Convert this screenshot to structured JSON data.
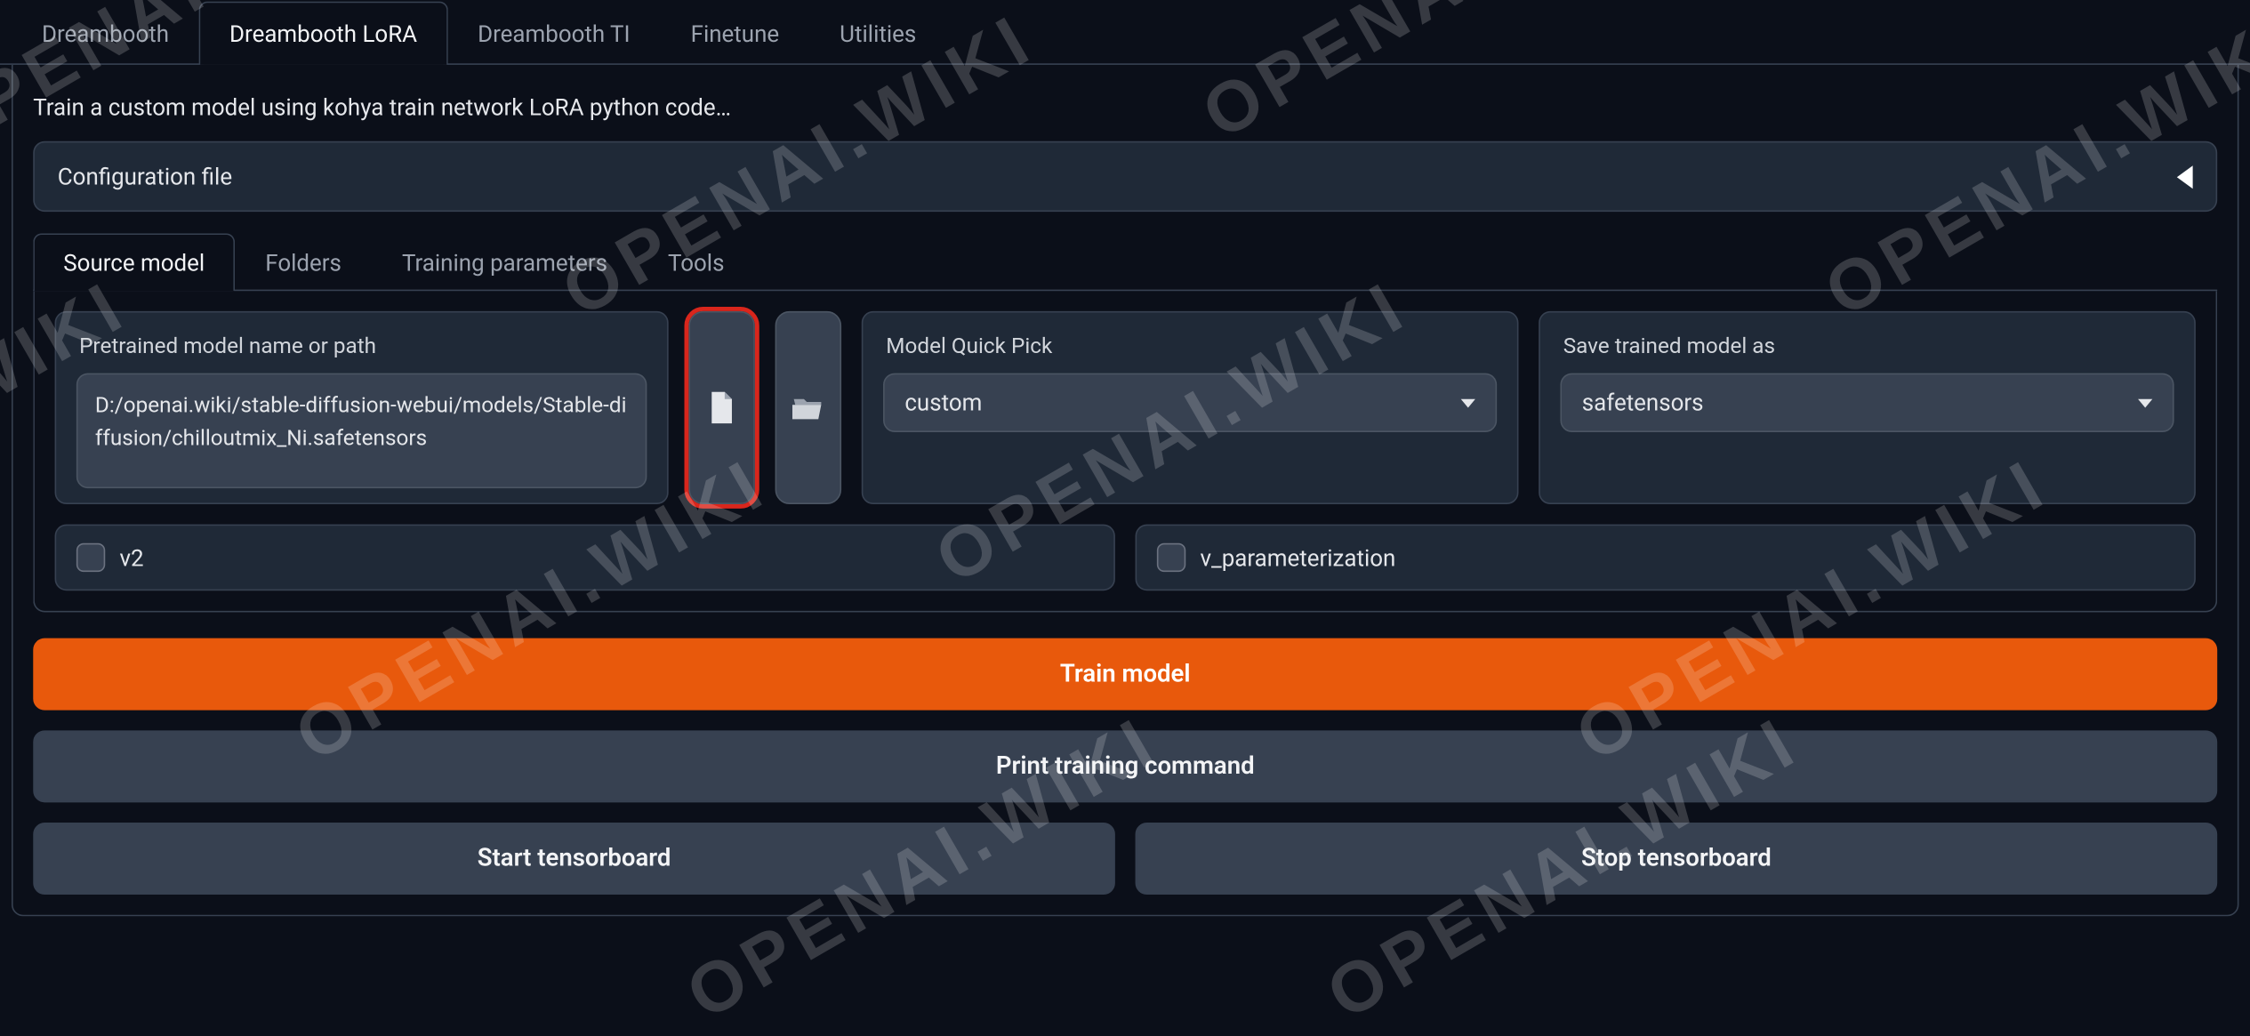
{
  "top_tabs": [
    {
      "label": "Dreambooth",
      "active": false
    },
    {
      "label": "Dreambooth LoRA",
      "active": true
    },
    {
      "label": "Dreambooth TI",
      "active": false
    },
    {
      "label": "Finetune",
      "active": false
    },
    {
      "label": "Utilities",
      "active": false
    }
  ],
  "description": "Train a custom model using kohya train network LoRA python code…",
  "config_file_label": "Configuration file",
  "inner_tabs": [
    {
      "label": "Source model",
      "active": true
    },
    {
      "label": "Folders",
      "active": false
    },
    {
      "label": "Training parameters",
      "active": false
    },
    {
      "label": "Tools",
      "active": false
    }
  ],
  "pretrained": {
    "label": "Pretrained model name or path",
    "value": "D:/openai.wiki/stable-diffusion-webui/models/Stable-diffusion/chilloutmix_Ni.safetensors"
  },
  "file_icon": "document-icon",
  "folder_icon": "folder-open-icon",
  "quick_pick": {
    "label": "Model Quick Pick",
    "value": "custom"
  },
  "save_as": {
    "label": "Save trained model as",
    "value": "safetensors"
  },
  "checks": {
    "v2": "v2",
    "vparam": "v_parameterization"
  },
  "buttons": {
    "train": "Train model",
    "print": "Print training command",
    "start_tb": "Start tensorboard",
    "stop_tb": "Stop tensorboard"
  },
  "watermark": "OPENAI.WIKI"
}
